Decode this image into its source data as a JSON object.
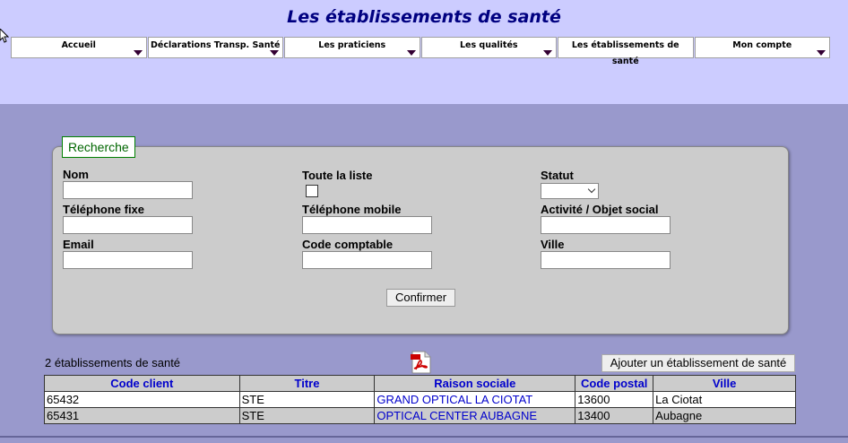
{
  "title": "Les établissements de santé",
  "nav": {
    "items": [
      {
        "label": "Accueil"
      },
      {
        "label": "Déclarations Transp. Santé"
      },
      {
        "label": "Les praticiens"
      },
      {
        "label": "Les qualités"
      },
      {
        "label": "Les établissements de santé"
      },
      {
        "label": "Mon compte"
      }
    ]
  },
  "search": {
    "legend": "Recherche",
    "nom_label": "Nom",
    "nom_value": "",
    "toute_liste_label": "Toute la liste",
    "statut_label": "Statut",
    "statut_value": "",
    "tel_fixe_label": "Téléphone fixe",
    "tel_fixe_value": "",
    "tel_mobile_label": "Téléphone mobile",
    "tel_mobile_value": "",
    "activite_label": "Activité / Objet social",
    "activite_value": "",
    "email_label": "Email",
    "email_value": "",
    "code_comptable_label": "Code comptable",
    "code_comptable_value": "",
    "ville_label": "Ville",
    "ville_value": "",
    "confirm_label": "Confirmer"
  },
  "results": {
    "count_text": "2 établissements de santé",
    "add_label": "Ajouter un établissement de santé",
    "columns": [
      "Code client",
      "Titre",
      "Raison sociale",
      "Code postal",
      "Ville"
    ],
    "rows": [
      [
        "65432",
        "STE",
        "GRAND OPTICAL LA CIOTAT",
        "13600",
        "La Ciotat"
      ],
      [
        "65431",
        "STE",
        "OPTICAL CENTER AUBAGNE",
        "13400",
        "Aubagne"
      ]
    ]
  }
}
